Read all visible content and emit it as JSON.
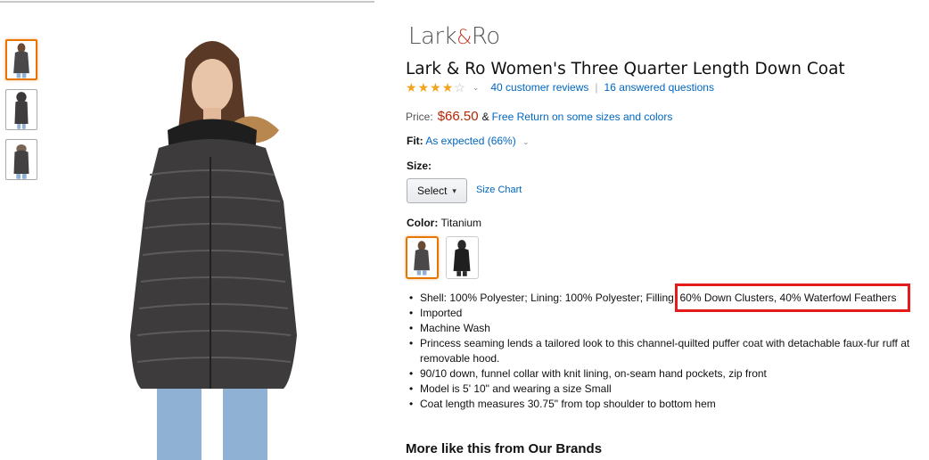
{
  "brand": {
    "name_left": "Lark",
    "amp": "&",
    "name_right": "Ro"
  },
  "product": {
    "title": "Lark & Ro Women's Three Quarter Length Down Coat",
    "rating": {
      "stars": 4,
      "max": 5,
      "reviews_link": "40 customer reviews",
      "questions_link": "16 answered questions",
      "separator": "|"
    },
    "price_label": "Price:",
    "price": "$66.50",
    "price_amp": "&",
    "free_return": "Free Return on some sizes and colors",
    "fit_label": "Fit:",
    "fit_value": "As expected (66%)",
    "size_label": "Size:",
    "size_select": "Select",
    "size_chart": "Size Chart",
    "color_label": "Color:",
    "color_value": "Titanium",
    "bullets": [
      "Shell: 100% Polyester; Lining: 100% Polyester; Filling: 60% Down Clusters, 40% Waterfowl Feathers",
      "Imported",
      "Machine Wash",
      "Princess seaming lends a tailored look to this channel-quilted puffer coat with detachable faux-fur ruff at removable hood.",
      "90/10 down, funnel collar with knit lining, on-seam hand pockets, zip front",
      "Model is 5' 10\" and wearing a size Small",
      "Coat length measures 30.75\" from top shoulder to bottom hem"
    ],
    "more_like": "More like this from Our Brands"
  },
  "colors": {
    "star": "#f4a41c",
    "price": "#b12704",
    "link": "#0066c0",
    "highlight": "#e41b1b",
    "active_border": "#e77600"
  },
  "icons": {
    "star_full": "star-full-icon",
    "star_empty": "star-empty-icon",
    "chevron": "chevron-down-icon"
  }
}
